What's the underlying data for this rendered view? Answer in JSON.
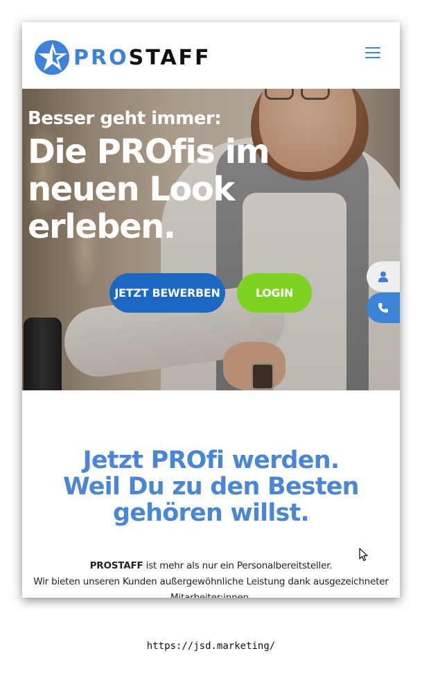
{
  "header": {
    "logo_pro": "PRO",
    "logo_staff": "STAFF",
    "menu_icon": "hamburger-menu-icon"
  },
  "hero": {
    "subtitle": "Besser geht immer:",
    "title": "Die PROfis im neuen Look erleben.",
    "apply_button": "JETZT BEWERBEN",
    "login_button": "LOGIN"
  },
  "side_tabs": {
    "user_icon": "user-icon",
    "phone_icon": "phone-icon"
  },
  "intro": {
    "line1_pre": "Jetzt ",
    "line1_bold": "PRO",
    "line1_post": "fi werden.",
    "line2": "Weil Du zu den Besten gehören willst."
  },
  "about": {
    "brand": "PROSTAFF",
    "line1_rest": " ist mehr als nur ein Personalbereitsteller.",
    "line2": "Wir bieten unseren Kunden außergewöhnliche Leistung dank ausgezeichneter",
    "line3": "Mitarbeiter:innen."
  },
  "footer": {
    "url": "https://jsd.marketing/"
  },
  "colors": {
    "brand_blue": "#3d82d9",
    "button_blue": "#1a67c4",
    "button_green": "#7ed321",
    "tagline_blue": "#4a86d6"
  }
}
